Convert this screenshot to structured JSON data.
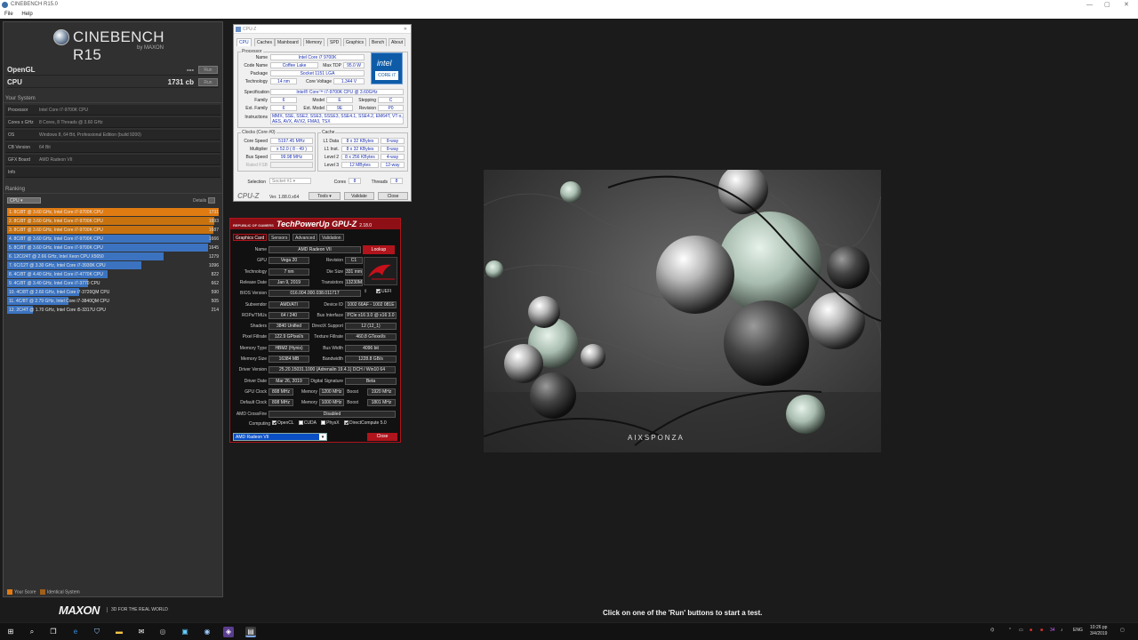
{
  "window": {
    "title": "CINEBENCH R15.0",
    "min": "—",
    "max": "▢",
    "close": "✕"
  },
  "menu": [
    "File",
    "Help"
  ],
  "cinebench": {
    "logo_title": "CINEBENCH R15",
    "logo_sub": "by MAXON",
    "tests": [
      {
        "label": "OpenGL",
        "value": "---",
        "run": "Run"
      },
      {
        "label": "CPU",
        "value": "1731 cb",
        "run": "Run"
      }
    ],
    "your_system_header": "Your System",
    "system": [
      {
        "key": "Processor",
        "value": "Intel Core i7-9700K CPU"
      },
      {
        "key": "Cores x GHz",
        "value": "8 Cores, 8 Threads @ 3.60 GHz"
      },
      {
        "key": "OS",
        "value": "Windows 8, 64 Bit, Professional Edition (build 9200)"
      },
      {
        "key": "CB Version",
        "value": "64 Bit"
      },
      {
        "key": "GFX Board",
        "value": "AMD Radeon VII"
      },
      {
        "key": "Info",
        "value": ""
      }
    ],
    "ranking_header": "Ranking",
    "ranking_select": "CPU",
    "details_label": "Details",
    "ranking": [
      {
        "label": "1. 8C/8T @ 3.60 GHz, Intel Core i7-9700K CPU",
        "score": "1731",
        "value": 1731,
        "kind": "own"
      },
      {
        "label": "2. 8C/8T @ 3.60 GHz, Intel Core i7-9700K CPU",
        "score": "1693",
        "value": 1693,
        "kind": "identical"
      },
      {
        "label": "3. 8C/8T @ 3.60 GHz, Intel Core i7-9700K CPU",
        "score": "1687",
        "value": 1687,
        "kind": "identical"
      },
      {
        "label": "4. 8C/8T @ 3.60 GHz, Intel Core i7-9700K CPU",
        "score": "1666",
        "value": 1666,
        "kind": "other"
      },
      {
        "label": "5. 8C/8T @ 3.60 GHz, Intel Core i7-9700K CPU",
        "score": "1645",
        "value": 1645,
        "kind": "other"
      },
      {
        "label": "6. 12C/24T @ 2.66 GHz, Intel Xeon CPU X5650",
        "score": "1279",
        "value": 1279,
        "kind": "other"
      },
      {
        "label": "7. 6C/12T @ 3.30 GHz, Intel Core i7-3930K CPU",
        "score": "1096",
        "value": 1096,
        "kind": "other"
      },
      {
        "label": "8. 4C/8T @ 4.40 GHz, Intel Core i7-4770K CPU",
        "score": "822",
        "value": 822,
        "kind": "other"
      },
      {
        "label": "9. 4C/8T @ 3.40 GHz, Intel Core i7-3770 CPU",
        "score": "662",
        "value": 662,
        "kind": "other"
      },
      {
        "label": "10. 4C/8T @ 2.60 GHz, Intel Core i7-3720QM CPU",
        "score": "590",
        "value": 590,
        "kind": "other"
      },
      {
        "label": "11. 4C/8T @ 2.79 GHz, Intel Core i7-3840QM CPU",
        "score": "505",
        "value": 505,
        "kind": "other"
      },
      {
        "label": "12. 2C/4T @ 1.70 GHz, Intel Core i5-3317U CPU",
        "score": "214",
        "value": 214,
        "kind": "other"
      }
    ],
    "ranking_max": 1731,
    "legend": {
      "your_score": "Your Score",
      "identical": "Identical System"
    },
    "footer_brand": "MAXON",
    "footer_tag": "3D FOR THE REAL WORLD",
    "status": "Click on one of the 'Run' buttons to start a test.",
    "render_brand": "AIXSPONZA"
  },
  "colors": {
    "own": "#e07b12",
    "identical": "#c8720f",
    "other": "#3b73c0",
    "own_legend": "#e07b12",
    "identical_legend": "#a0601a"
  },
  "cpuz": {
    "title": "CPU-Z",
    "tabs": [
      "CPU",
      "Caches",
      "Mainboard",
      "Memory",
      "SPD",
      "Graphics",
      "Bench",
      "About"
    ],
    "processor_group": "Processor",
    "name_l": "Name",
    "name": "Intel Core i7 9700K",
    "codename_l": "Code Name",
    "codename": "Coffee Lake",
    "maxtdp_l": "Max TDP",
    "maxtdp": "95.0 W",
    "package_l": "Package",
    "package": "Socket 1151 LGA",
    "tech_l": "Technology",
    "tech": "14 nm",
    "corev_l": "Core Voltage",
    "corev": "1.344 V",
    "spec_l": "Specification",
    "spec": "Intel® Core™ i7-9700K CPU @ 3.60GHz",
    "family_l": "Family",
    "family": "6",
    "model_l": "Model",
    "model": "E",
    "stepping_l": "Stepping",
    "stepping": "C",
    "extfamily_l": "Ext. Family",
    "extfamily": "6",
    "extmodel_l": "Ext. Model",
    "extmodel": "9E",
    "revision_l": "Revision",
    "revision": "P0",
    "instr_l": "Instructions",
    "instr": "MMX, SSE, SSE2, SSE3, SSSE3, SSE4.1, SSE4.2, EM64T, VT-x, AES, AVX, AVX2, FMA3, TSX",
    "intel_word": "intel",
    "intel_badge": "CORE i7",
    "clocks_group": "Clocks (Core #0)",
    "corespeed_l": "Core Speed",
    "corespeed": "5197.45 MHz",
    "mult_l": "Multiplier",
    "mult": "x 52.0 ( 8 - 49 )",
    "bus_l": "Bus Speed",
    "bus": "99.98 MHz",
    "ratedfsb_l": "Rated FSB",
    "ratedfsb": "",
    "cache_group": "Cache",
    "l1d_l": "L1 Data",
    "l1d": "8 x 32 KBytes",
    "l1d_w": "8-way",
    "l1i_l": "L1 Inst.",
    "l1i": "8 x 32 KBytes",
    "l1i_w": "8-way",
    "l2_l": "Level 2",
    "l2": "8 x 256 KBytes",
    "l2_w": "4-way",
    "l3_l": "Level 3",
    "l3": "12 MBytes",
    "l3_w": "12-way",
    "selection_l": "Selection",
    "selection": "Socket #1",
    "cores_l": "Cores",
    "cores": "8",
    "threads_l": "Threads",
    "threads": "8",
    "brand": "CPU-Z",
    "version": "Ver. 1.88.0.x64",
    "tools": "Tools",
    "validate": "Validate",
    "close": "Close"
  },
  "gpuz": {
    "title": "TechPowerUp GPU-Z",
    "version": "2.18.0",
    "rog": "REPUBLIC OF GAMERS",
    "tabs": [
      "Graphics Card",
      "Sensors",
      "Advanced",
      "Validation"
    ],
    "rows": [
      {
        "l": "Name",
        "v": "AMD Radeon VII"
      },
      {
        "l": "GPU",
        "v": "Vega 20",
        "l2": "Revision",
        "v2": "C1"
      },
      {
        "l": "Technology",
        "v": "7 nm",
        "l2": "Die Size",
        "v2": "331 mm²"
      },
      {
        "l": "Release Date",
        "v": "Jan 9, 2019",
        "l2": "Transistors",
        "v2": "13230M"
      },
      {
        "l": "BIOS Version",
        "v": "016.004.000.038.011717"
      },
      {
        "l": "Subvendor",
        "v": "AMD/ATI",
        "l2": "Device ID",
        "v2": "1002 66AF - 1002 081E"
      },
      {
        "l": "ROPs/TMUs",
        "v": "64 / 240",
        "l2": "Bus Interface",
        "v2": "PCIe x16 3.0 @ x16 3.0"
      },
      {
        "l": "Shaders",
        "v": "3840 Unified",
        "l2": "DirectX Support",
        "v2": "12 (12_1)"
      },
      {
        "l": "Pixel Fillrate",
        "v": "122.9 GPixel/s",
        "l2": "Texture Fillrate",
        "v2": "460.8 GTexel/s"
      },
      {
        "l": "Memory Type",
        "v": "HBM2 (Hynix)",
        "l2": "Bus Width",
        "v2": "4096 bit"
      },
      {
        "l": "Memory Size",
        "v": "16384 MB",
        "l2": "Bandwidth",
        "v2": "1228.8 GB/s"
      },
      {
        "l": "Driver Version",
        "v": "25.20.15031.1000 (Adrenalin 19.4.1) DCH / Win10 64"
      },
      {
        "l": "Driver Date",
        "v": "Mar 26, 2019",
        "l2": "Digital Signature",
        "v2": "Beta"
      },
      {
        "l": "GPU Clock",
        "v": "808 MHz",
        "l2": "Memory",
        "v2": "1200 MHz",
        "l3": "Boost",
        "v3": "1920 MHz"
      },
      {
        "l": "Default Clock",
        "v": "808 MHz",
        "l2": "Memory",
        "v2": "1000 MHz",
        "l3": "Boost",
        "v3": "1801 MHz"
      },
      {
        "l": "AMD CrossFire",
        "v": "Disabled"
      }
    ],
    "lookup": "Lookup",
    "uefi": "UEFI",
    "computing_l": "Computing",
    "computing": [
      {
        "label": "OpenCL",
        "checked": true
      },
      {
        "label": "CUDA",
        "checked": false
      },
      {
        "label": "PhysX",
        "checked": false
      },
      {
        "label": "DirectCompute 5.0",
        "checked": true
      }
    ],
    "card_select": "AMD Radeon VII",
    "close": "Close"
  },
  "taskbar": {
    "tray_lang": "ENG",
    "tray_time": "10:26 pp",
    "tray_date": "3/4/2019",
    "tray_temp": "34"
  }
}
